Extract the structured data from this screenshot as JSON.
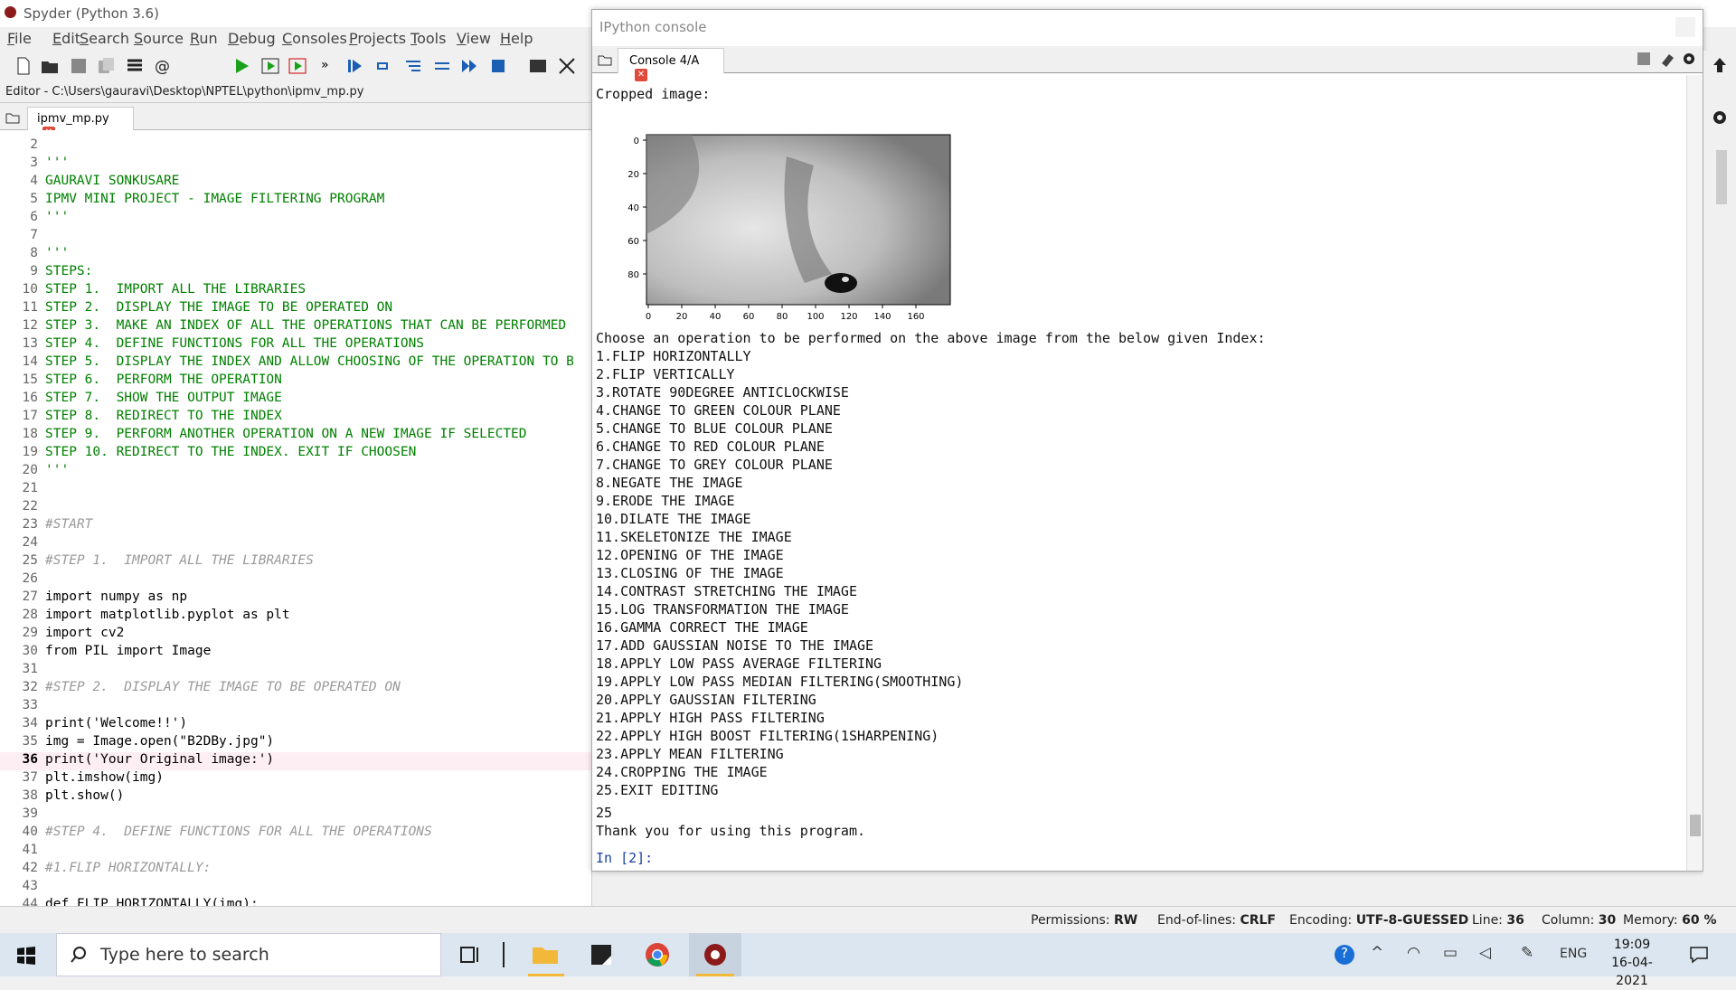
{
  "window": {
    "title": "Spyder (Python 3.6)"
  },
  "menu": [
    "File",
    "Edit",
    "Search",
    "Source",
    "Run",
    "Debug",
    "Consoles",
    "Projects",
    "Tools",
    "View",
    "Help"
  ],
  "editor": {
    "path": "Editor - C:\\Users\\gauravi\\Desktop\\NPTEL\\python\\ipmv_mp.py",
    "tab": "ipmv_mp.py",
    "lines": [
      {
        "n": "2",
        "t": "",
        "k": "plain"
      },
      {
        "n": "3",
        "t": "'''",
        "k": "str"
      },
      {
        "n": "4",
        "t": "GAURAVI SONKUSARE",
        "k": "str"
      },
      {
        "n": "5",
        "t": "IPMV MINI PROJECT - IMAGE FILTERING PROGRAM",
        "k": "str"
      },
      {
        "n": "6",
        "t": "'''",
        "k": "str"
      },
      {
        "n": "7",
        "t": "",
        "k": "plain"
      },
      {
        "n": "8",
        "t": "'''",
        "k": "str"
      },
      {
        "n": "9",
        "t": "STEPS:",
        "k": "str"
      },
      {
        "n": "10",
        "t": "STEP 1.  IMPORT ALL THE LIBRARIES",
        "k": "str"
      },
      {
        "n": "11",
        "t": "STEP 2.  DISPLAY THE IMAGE TO BE OPERATED ON",
        "k": "str"
      },
      {
        "n": "12",
        "t": "STEP 3.  MAKE AN INDEX OF ALL THE OPERATIONS THAT CAN BE PERFORMED",
        "k": "str"
      },
      {
        "n": "13",
        "t": "STEP 4.  DEFINE FUNCTIONS FOR ALL THE OPERATIONS",
        "k": "str"
      },
      {
        "n": "14",
        "t": "STEP 5.  DISPLAY THE INDEX AND ALLOW CHOOSING OF THE OPERATION TO B",
        "k": "str"
      },
      {
        "n": "15",
        "t": "STEP 6.  PERFORM THE OPERATION",
        "k": "str"
      },
      {
        "n": "16",
        "t": "STEP 7.  SHOW THE OUTPUT IMAGE",
        "k": "str"
      },
      {
        "n": "17",
        "t": "STEP 8.  REDIRECT TO THE INDEX",
        "k": "str"
      },
      {
        "n": "18",
        "t": "STEP 9.  PERFORM ANOTHER OPERATION ON A NEW IMAGE IF SELECTED",
        "k": "str"
      },
      {
        "n": "19",
        "t": "STEP 10. REDIRECT TO THE INDEX. EXIT IF CHOOSEN",
        "k": "str"
      },
      {
        "n": "20",
        "t": "'''",
        "k": "str"
      },
      {
        "n": "21",
        "t": "",
        "k": "plain"
      },
      {
        "n": "22",
        "t": "",
        "k": "plain"
      },
      {
        "n": "23",
        "t": "#START",
        "k": "com"
      },
      {
        "n": "24",
        "t": "",
        "k": "plain"
      },
      {
        "n": "25",
        "t": "#STEP 1.  IMPORT ALL THE LIBRARIES",
        "k": "com"
      },
      {
        "n": "26",
        "t": "",
        "k": "plain"
      },
      {
        "n": "27",
        "t": "import numpy as np",
        "k": "plain"
      },
      {
        "n": "28",
        "t": "import matplotlib.pyplot as plt",
        "k": "plain"
      },
      {
        "n": "29",
        "t": "import cv2",
        "k": "plain"
      },
      {
        "n": "30",
        "t": "from PIL import Image",
        "k": "plain"
      },
      {
        "n": "31",
        "t": "",
        "k": "plain"
      },
      {
        "n": "32",
        "t": "#STEP 2.  DISPLAY THE IMAGE TO BE OPERATED ON",
        "k": "com"
      },
      {
        "n": "33",
        "t": "",
        "k": "plain"
      },
      {
        "n": "34",
        "t": "print('Welcome!!')",
        "k": "plain"
      },
      {
        "n": "35",
        "t": "img = Image.open(\"B2DBy.jpg\")",
        "k": "plain"
      },
      {
        "n": "36",
        "t": "print('Your Original image:')",
        "k": "plain"
      },
      {
        "n": "37",
        "t": "plt.imshow(img)",
        "k": "plain"
      },
      {
        "n": "38",
        "t": "plt.show()",
        "k": "plain"
      },
      {
        "n": "39",
        "t": "",
        "k": "plain"
      },
      {
        "n": "40",
        "t": "#STEP 4.  DEFINE FUNCTIONS FOR ALL THE OPERATIONS",
        "k": "com"
      },
      {
        "n": "41",
        "t": "",
        "k": "plain"
      },
      {
        "n": "42",
        "t": "#1.FLIP HORIZONTALLY:",
        "k": "com"
      },
      {
        "n": "43",
        "t": "",
        "k": "plain"
      },
      {
        "n": "44",
        "t": "def FLIP_HORIZONTALLY(img):",
        "k": "plain"
      }
    ],
    "current_line": "36"
  },
  "console": {
    "pane_title": "IPython console",
    "tab": "Console 4/A",
    "cropped_label": "Cropped image:",
    "prompt_intro": "Choose an operation to be performed on the above image from the below given Index:",
    "options": [
      "1.FLIP HORIZONTALLY",
      "2.FLIP VERTICALLY",
      "3.ROTATE 90DEGREE ANTICLOCKWISE",
      "4.CHANGE TO GREEN COLOUR PLANE",
      "5.CHANGE TO BLUE COLOUR PLANE",
      "6.CHANGE TO RED COLOUR PLANE",
      "7.CHANGE TO GREY COLOUR PLANE",
      "8.NEGATE THE IMAGE",
      "9.ERODE THE IMAGE",
      "10.DILATE THE IMAGE",
      "11.SKELETONIZE THE IMAGE",
      "12.OPENING OF THE IMAGE",
      "13.CLOSING OF THE IMAGE",
      "14.CONTRAST STRETCHING THE IMAGE",
      "15.LOG TRANSFORMATION THE IMAGE",
      "16.GAMMA CORRECT THE IMAGE",
      "17.ADD GAUSSIAN NOISE TO THE IMAGE",
      "18.APPLY LOW PASS AVERAGE FILTERING",
      "19.APPLY LOW PASS MEDIAN FILTERING(SMOOTHING)",
      "20.APPLY GAUSSIAN FILTERING",
      "21.APPLY HIGH PASS FILTERING",
      "22.APPLY HIGH BOOST FILTERING(1SHARPENING)",
      "23.APPLY MEAN FILTERING",
      "24.CROPPING THE IMAGE",
      "25.EXIT EDITING"
    ],
    "input_value": "25",
    "thanks": "Thank you for using this program.",
    "prompt": "In [2]:",
    "plot": {
      "yticks": [
        "0",
        "20",
        "40",
        "60",
        "80"
      ],
      "xticks": [
        "0",
        "20",
        "40",
        "60",
        "80",
        "100",
        "120",
        "140",
        "160"
      ]
    }
  },
  "status": {
    "permissions_label": "Permissions:",
    "permissions": "RW",
    "eol_label": "End-of-lines:",
    "eol": "CRLF",
    "encoding_label": "Encoding:",
    "encoding": "UTF-8-GUESSED",
    "line_label": "Line:",
    "line": "36",
    "column_label": "Column:",
    "column": "30",
    "memory_label": "Memory:",
    "memory": "60 %"
  },
  "taskbar": {
    "search_placeholder": "Type here to search",
    "lang": "ENG",
    "time": "19:09",
    "date": "16-04-2021"
  },
  "colors": {
    "string": "#008000",
    "comment": "#999999",
    "keyword": "#0000aa",
    "close": "#e04a3a"
  }
}
